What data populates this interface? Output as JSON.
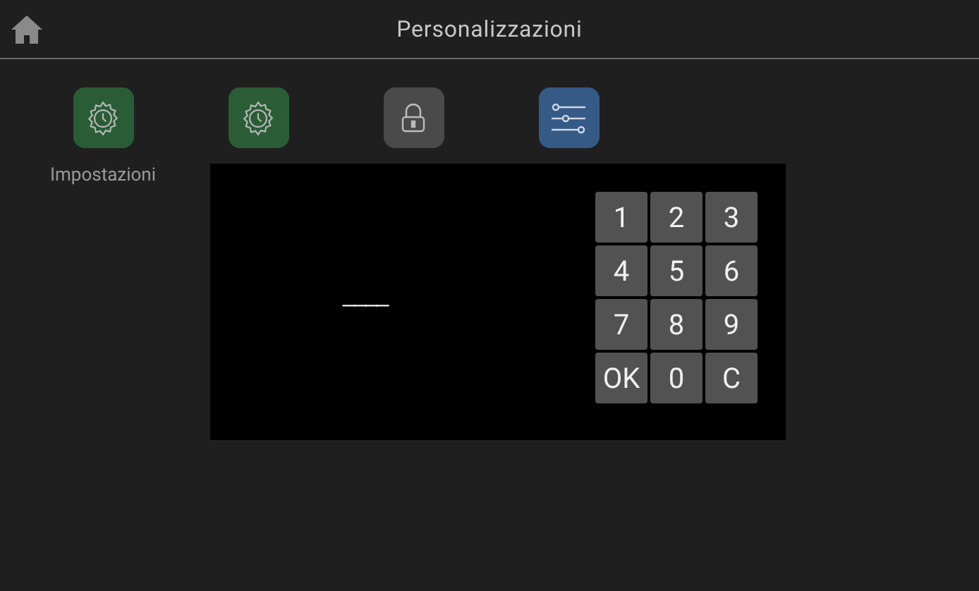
{
  "header": {
    "title": "Personalizzazioni"
  },
  "tiles": [
    {
      "kind": "clock-gear",
      "label": "Impostazioni"
    },
    {
      "kind": "clock-gear"
    },
    {
      "kind": "lock"
    },
    {
      "kind": "sliders"
    }
  ],
  "pin_dialog": {
    "display": "____",
    "keys": [
      "1",
      "2",
      "3",
      "4",
      "5",
      "6",
      "7",
      "8",
      "9",
      "OK",
      "0",
      "C"
    ]
  }
}
